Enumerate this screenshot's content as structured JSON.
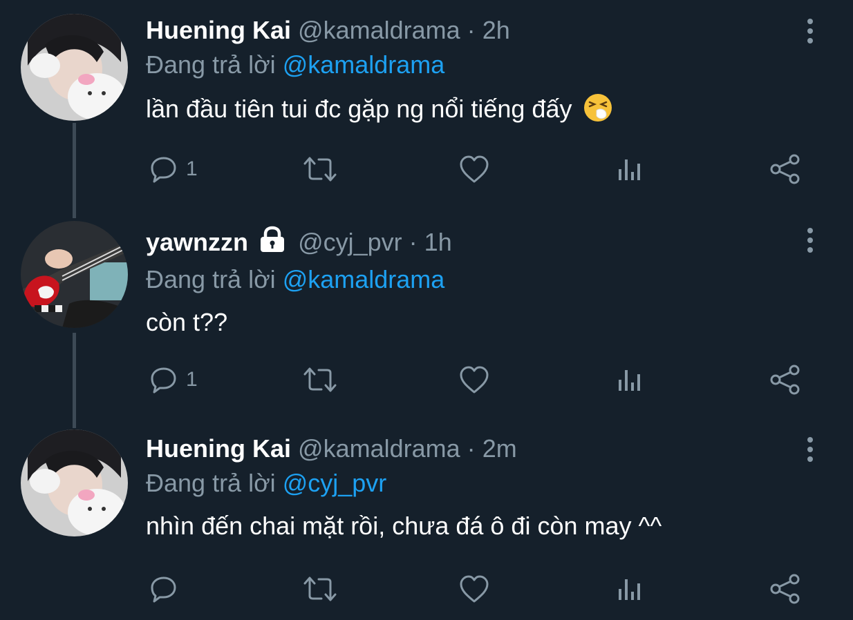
{
  "tweets": [
    {
      "name": "Huening Kai",
      "handle": "@kamaldrama",
      "dot": "·",
      "time": "2h",
      "reply_prefix": "Đang trả lời",
      "reply_to": "@kamaldrama",
      "text": "lần đầu tiên tui đc gặp ng nổi tiếng đấy",
      "emoji": "sneezing-face-icon",
      "reply_count": "1",
      "locked": false
    },
    {
      "name": "yawnzzn",
      "handle": "@cyj_pvr",
      "dot": "·",
      "time": "1h",
      "reply_prefix": "Đang trả lời",
      "reply_to": "@kamaldrama",
      "text": "còn t??",
      "reply_count": "1",
      "locked": true
    },
    {
      "name": "Huening Kai",
      "handle": "@kamaldrama",
      "dot": "·",
      "time": "2m",
      "reply_prefix": "Đang trả lời",
      "reply_to": "@cyj_pvr",
      "text": "nhìn đến chai mặt rồi, chưa đá ô đi còn may ^^",
      "reply_count": "",
      "locked": false
    }
  ],
  "colors": {
    "background": "#15202b",
    "secondary_text": "#8899a6",
    "link": "#1da1f2",
    "thread_line": "#3d4a56"
  }
}
